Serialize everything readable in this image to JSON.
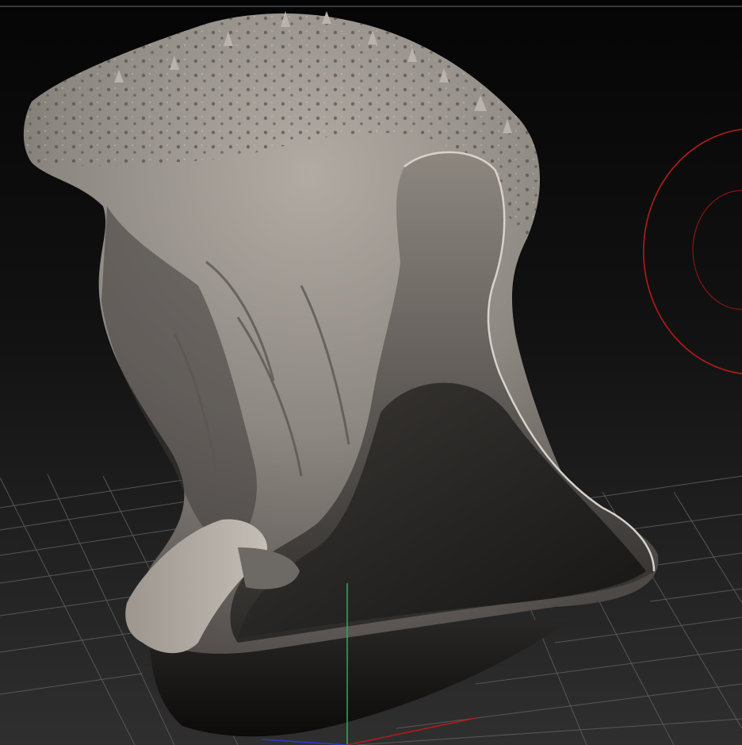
{
  "viewport": {
    "background_top": "#060606",
    "background_bottom": "#2e2e2e",
    "top_border_color": "#7a7a7a",
    "grid_color": "#6b6b6b",
    "model_color": "#9c968f",
    "model_shadow_color": "#2a2827",
    "gizmo_ring_color": "#c01818",
    "axis_y_color": "#1fbf3a",
    "axis_x_color": "#c01818",
    "axis_z_color": "#2a3ad0"
  }
}
